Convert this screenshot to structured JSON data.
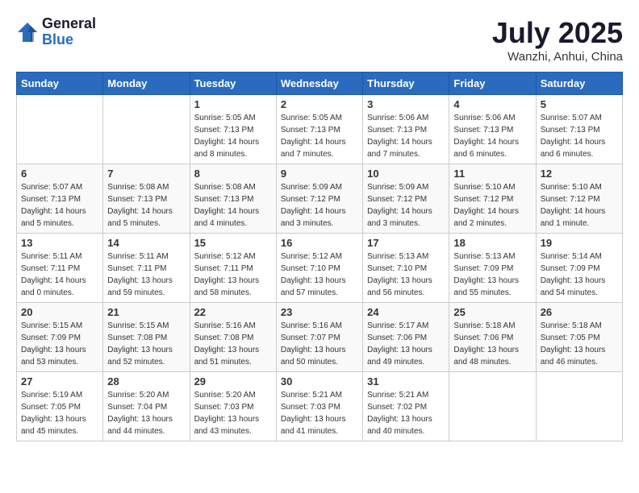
{
  "logo": {
    "general": "General",
    "blue": "Blue"
  },
  "title": {
    "month": "July 2025",
    "location": "Wanzhi, Anhui, China"
  },
  "weekdays": [
    "Sunday",
    "Monday",
    "Tuesday",
    "Wednesday",
    "Thursday",
    "Friday",
    "Saturday"
  ],
  "weeks": [
    [
      {
        "day": "",
        "info": ""
      },
      {
        "day": "",
        "info": ""
      },
      {
        "day": "1",
        "info": "Sunrise: 5:05 AM\nSunset: 7:13 PM\nDaylight: 14 hours and 8 minutes."
      },
      {
        "day": "2",
        "info": "Sunrise: 5:05 AM\nSunset: 7:13 PM\nDaylight: 14 hours and 7 minutes."
      },
      {
        "day": "3",
        "info": "Sunrise: 5:06 AM\nSunset: 7:13 PM\nDaylight: 14 hours and 7 minutes."
      },
      {
        "day": "4",
        "info": "Sunrise: 5:06 AM\nSunset: 7:13 PM\nDaylight: 14 hours and 6 minutes."
      },
      {
        "day": "5",
        "info": "Sunrise: 5:07 AM\nSunset: 7:13 PM\nDaylight: 14 hours and 6 minutes."
      }
    ],
    [
      {
        "day": "6",
        "info": "Sunrise: 5:07 AM\nSunset: 7:13 PM\nDaylight: 14 hours and 5 minutes."
      },
      {
        "day": "7",
        "info": "Sunrise: 5:08 AM\nSunset: 7:13 PM\nDaylight: 14 hours and 5 minutes."
      },
      {
        "day": "8",
        "info": "Sunrise: 5:08 AM\nSunset: 7:13 PM\nDaylight: 14 hours and 4 minutes."
      },
      {
        "day": "9",
        "info": "Sunrise: 5:09 AM\nSunset: 7:12 PM\nDaylight: 14 hours and 3 minutes."
      },
      {
        "day": "10",
        "info": "Sunrise: 5:09 AM\nSunset: 7:12 PM\nDaylight: 14 hours and 3 minutes."
      },
      {
        "day": "11",
        "info": "Sunrise: 5:10 AM\nSunset: 7:12 PM\nDaylight: 14 hours and 2 minutes."
      },
      {
        "day": "12",
        "info": "Sunrise: 5:10 AM\nSunset: 7:12 PM\nDaylight: 14 hours and 1 minute."
      }
    ],
    [
      {
        "day": "13",
        "info": "Sunrise: 5:11 AM\nSunset: 7:11 PM\nDaylight: 14 hours and 0 minutes."
      },
      {
        "day": "14",
        "info": "Sunrise: 5:11 AM\nSunset: 7:11 PM\nDaylight: 13 hours and 59 minutes."
      },
      {
        "day": "15",
        "info": "Sunrise: 5:12 AM\nSunset: 7:11 PM\nDaylight: 13 hours and 58 minutes."
      },
      {
        "day": "16",
        "info": "Sunrise: 5:12 AM\nSunset: 7:10 PM\nDaylight: 13 hours and 57 minutes."
      },
      {
        "day": "17",
        "info": "Sunrise: 5:13 AM\nSunset: 7:10 PM\nDaylight: 13 hours and 56 minutes."
      },
      {
        "day": "18",
        "info": "Sunrise: 5:13 AM\nSunset: 7:09 PM\nDaylight: 13 hours and 55 minutes."
      },
      {
        "day": "19",
        "info": "Sunrise: 5:14 AM\nSunset: 7:09 PM\nDaylight: 13 hours and 54 minutes."
      }
    ],
    [
      {
        "day": "20",
        "info": "Sunrise: 5:15 AM\nSunset: 7:09 PM\nDaylight: 13 hours and 53 minutes."
      },
      {
        "day": "21",
        "info": "Sunrise: 5:15 AM\nSunset: 7:08 PM\nDaylight: 13 hours and 52 minutes."
      },
      {
        "day": "22",
        "info": "Sunrise: 5:16 AM\nSunset: 7:08 PM\nDaylight: 13 hours and 51 minutes."
      },
      {
        "day": "23",
        "info": "Sunrise: 5:16 AM\nSunset: 7:07 PM\nDaylight: 13 hours and 50 minutes."
      },
      {
        "day": "24",
        "info": "Sunrise: 5:17 AM\nSunset: 7:06 PM\nDaylight: 13 hours and 49 minutes."
      },
      {
        "day": "25",
        "info": "Sunrise: 5:18 AM\nSunset: 7:06 PM\nDaylight: 13 hours and 48 minutes."
      },
      {
        "day": "26",
        "info": "Sunrise: 5:18 AM\nSunset: 7:05 PM\nDaylight: 13 hours and 46 minutes."
      }
    ],
    [
      {
        "day": "27",
        "info": "Sunrise: 5:19 AM\nSunset: 7:05 PM\nDaylight: 13 hours and 45 minutes."
      },
      {
        "day": "28",
        "info": "Sunrise: 5:20 AM\nSunset: 7:04 PM\nDaylight: 13 hours and 44 minutes."
      },
      {
        "day": "29",
        "info": "Sunrise: 5:20 AM\nSunset: 7:03 PM\nDaylight: 13 hours and 43 minutes."
      },
      {
        "day": "30",
        "info": "Sunrise: 5:21 AM\nSunset: 7:03 PM\nDaylight: 13 hours and 41 minutes."
      },
      {
        "day": "31",
        "info": "Sunrise: 5:21 AM\nSunset: 7:02 PM\nDaylight: 13 hours and 40 minutes."
      },
      {
        "day": "",
        "info": ""
      },
      {
        "day": "",
        "info": ""
      }
    ]
  ]
}
